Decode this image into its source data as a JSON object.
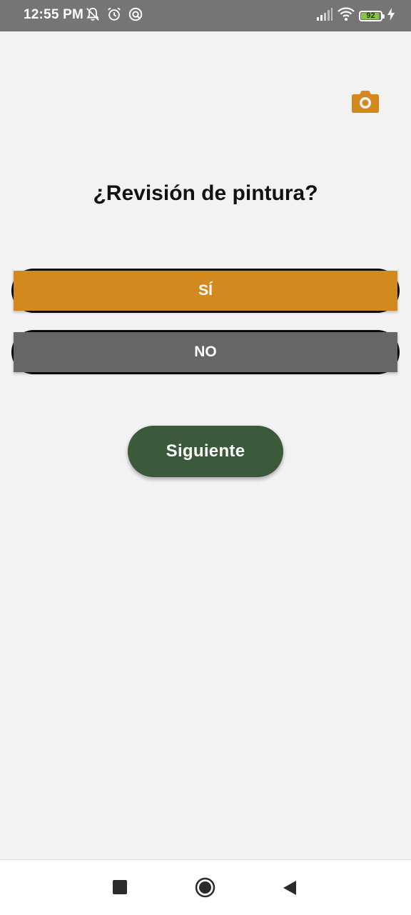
{
  "status_bar": {
    "time": "12:55 PM",
    "battery_level": "92",
    "icons": [
      "notifications-off-icon",
      "alarm-icon",
      "sync-icon",
      "signal-icon",
      "wifi-icon",
      "battery-icon",
      "charging-icon"
    ]
  },
  "header": {
    "camera_icon": "camera-icon"
  },
  "question": {
    "text": "¿Revisión de pintura?"
  },
  "options": [
    {
      "label": "SÍ",
      "color": "#d4891f"
    },
    {
      "label": "NO",
      "color": "#666666"
    }
  ],
  "next_button": {
    "label": "Siguiente",
    "color": "#3a5a3b"
  },
  "navigation": {
    "icons": [
      "recents-icon",
      "home-icon",
      "back-icon"
    ]
  },
  "colors": {
    "accent": "#d4891f",
    "background": "#f2f2f2",
    "status_bar": "#757575"
  }
}
